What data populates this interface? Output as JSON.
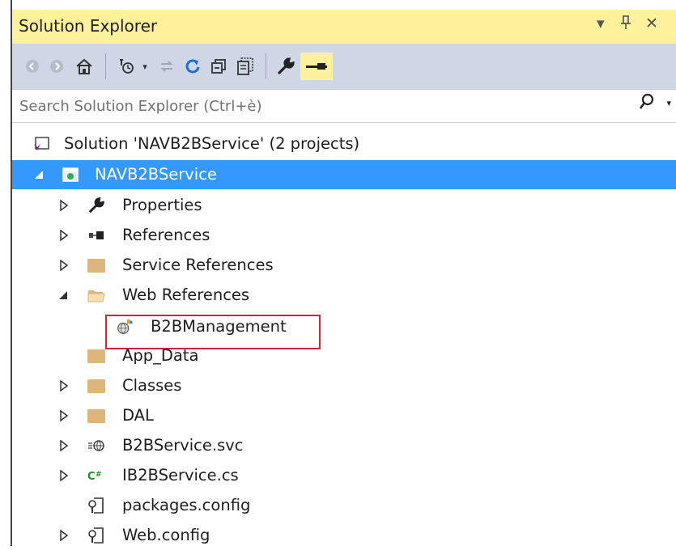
{
  "window": {
    "title": "Solution Explorer",
    "controls": {
      "dropdown": "▾",
      "pin": "ᛘ",
      "close": "✕"
    }
  },
  "toolbar": {
    "icons": [
      "back-icon",
      "forward-icon",
      "home-icon",
      "pending-changes-icon",
      "sync-icon",
      "refresh-icon",
      "collapse-all-icon",
      "show-all-files-icon",
      "properties-icon",
      "preview-selected-icon"
    ]
  },
  "search": {
    "placeholder": "Search Solution Explorer (Ctrl+è)",
    "icon": "search-icon"
  },
  "tree": {
    "solution": "Solution 'NAVB2BService' (2 projects)",
    "project": "NAVB2BService",
    "items": [
      {
        "label": "Properties",
        "icon": "wrench-icon",
        "expander": "collapsed"
      },
      {
        "label": "References",
        "icon": "references-icon",
        "expander": "collapsed"
      },
      {
        "label": "Service References",
        "icon": "folder-icon",
        "expander": "collapsed"
      },
      {
        "label": "Web References",
        "icon": "folder-open-icon",
        "expander": "expanded"
      },
      {
        "label": "B2BManagement",
        "icon": "web-reference-icon",
        "expander": "none"
      },
      {
        "label": "App_Data",
        "icon": "folder-icon",
        "expander": "none"
      },
      {
        "label": "Classes",
        "icon": "folder-icon",
        "expander": "collapsed"
      },
      {
        "label": "DAL",
        "icon": "folder-icon",
        "expander": "collapsed"
      },
      {
        "label": "B2BService.svc",
        "icon": "svc-file-icon",
        "expander": "collapsed"
      },
      {
        "label": "IB2BService.cs",
        "icon": "csharp-file-icon",
        "expander": "collapsed"
      },
      {
        "label": "packages.config",
        "icon": "config-file-icon",
        "expander": "none"
      },
      {
        "label": "Web.config",
        "icon": "config-file-icon",
        "expander": "collapsed"
      }
    ]
  },
  "colors": {
    "title_bg": "#fff29d",
    "toolbar_bg": "#cfd6e5",
    "selection": "#3399ff",
    "highlight_border": "#c8293a",
    "folder": "#dcb67a"
  }
}
